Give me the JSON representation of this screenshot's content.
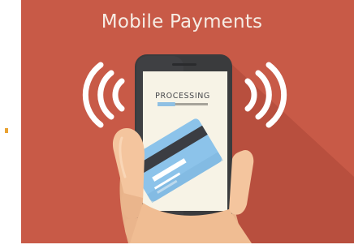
{
  "banner": {
    "title": "Mobile Payments"
  },
  "phone": {
    "screen": {
      "status_text": "PROCESSING",
      "progress_fraction": 0.35
    }
  },
  "colors": {
    "background": "#c85a47",
    "phone_body": "#3a3b3d",
    "screen": "#f7f3e6",
    "card": "#8cc3ea",
    "progress_fill": "#8fc0e3",
    "progress_track": "#a6a39a",
    "hand": "#f4c59e",
    "signal_waves": "#ffffff"
  },
  "icons": [
    "nfc-waves-left-icon",
    "nfc-waves-right-icon"
  ]
}
